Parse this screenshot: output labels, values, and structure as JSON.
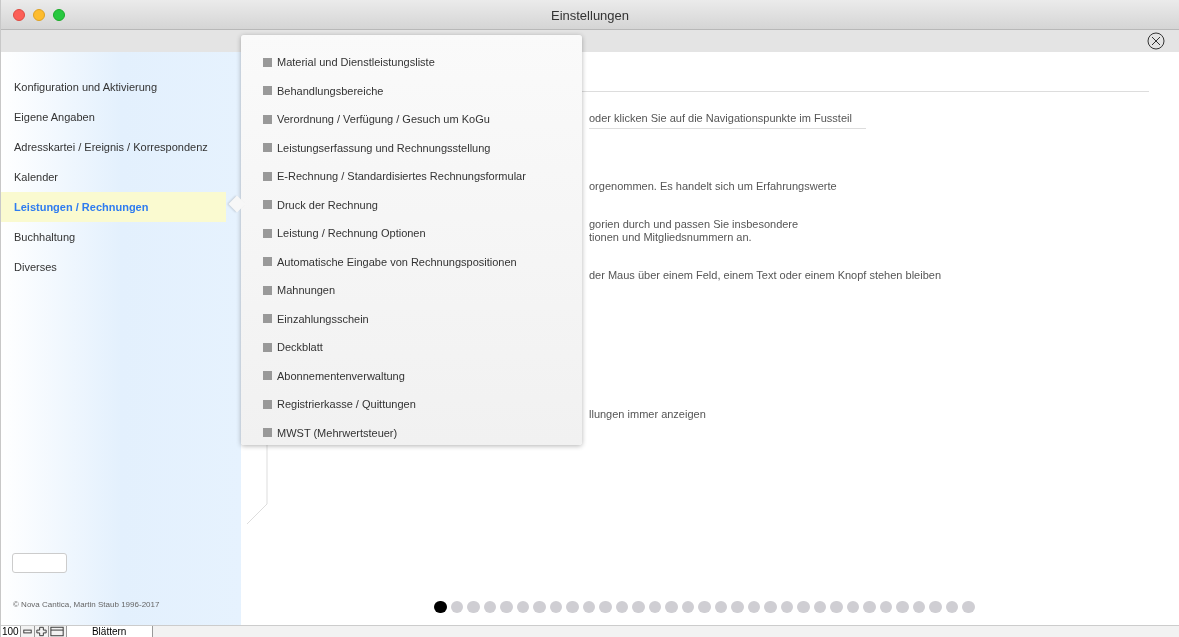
{
  "window": {
    "title": "Einstellungen"
  },
  "sidebar": {
    "items": [
      {
        "label": "Konfiguration und Aktivierung",
        "selected": false
      },
      {
        "label": "Eigene Angaben",
        "selected": false
      },
      {
        "label": "Adresskartei / Ereignis / Korrespondenz",
        "selected": false
      },
      {
        "label": "Kalender",
        "selected": false
      },
      {
        "label": "Leistungen / Rechnungen",
        "selected": true
      },
      {
        "label": "Buchhaltung",
        "selected": false
      },
      {
        "label": "Diverses",
        "selected": false
      }
    ],
    "copyright": "© Nova Cantica, Martin Staub 1996-2017"
  },
  "submenu": {
    "items": [
      "Material und Dienstleistungsliste",
      "Behandlungsbereiche",
      "Verordnung / Verfügung / Gesuch um KoGu",
      "Leistungserfassung und Rechnungsstellung",
      "E-Rechnung / Standardisiertes Rechnungsformular",
      "Druck der Rechnung",
      "Leistung / Rechnung Optionen",
      "Automatische Eingabe von Rechnungspositionen",
      "Mahnungen",
      "Einzahlungsschein",
      "Deckblatt",
      "Abonnementenverwaltung",
      "Registrierkasse / Quittungen",
      "MWST (Mehrwertsteuer)"
    ]
  },
  "content": {
    "link": "oder klicken Sie auf die Navigationspunkte im Fussteil",
    "paragraphs": [
      [
        "orgenommen. Es handelt sich um Erfahrungswerte"
      ],
      [
        "gorien durch und passen Sie insbesondere",
        "tionen und Mitgliedsnummern an."
      ],
      [
        "der Maus über einem Feld, einem Text oder einem Knopf stehen bleiben"
      ]
    ],
    "option": "llungen immer anzeigen"
  },
  "pager": {
    "dots": [
      {
        "selected": true
      },
      {
        "selected": false
      },
      {
        "selected": false
      },
      {
        "selected": false
      },
      {
        "selected": false
      },
      {
        "selected": false
      },
      {
        "selected": false
      },
      {
        "selected": false
      },
      {
        "selected": false
      },
      {
        "selected": false
      },
      {
        "selected": false
      },
      {
        "selected": false
      },
      {
        "selected": false
      },
      {
        "selected": false
      },
      {
        "selected": false
      },
      {
        "selected": false
      },
      {
        "selected": false
      },
      {
        "selected": false
      },
      {
        "selected": false
      },
      {
        "selected": false
      },
      {
        "selected": false
      },
      {
        "selected": false
      },
      {
        "selected": false
      },
      {
        "selected": false
      },
      {
        "selected": false
      },
      {
        "selected": false
      },
      {
        "selected": false
      },
      {
        "selected": false
      },
      {
        "selected": false
      },
      {
        "selected": false
      },
      {
        "selected": false
      },
      {
        "selected": false
      },
      {
        "selected": false
      }
    ]
  },
  "status_bar": {
    "zoom": "100",
    "mode": "Blättern"
  }
}
